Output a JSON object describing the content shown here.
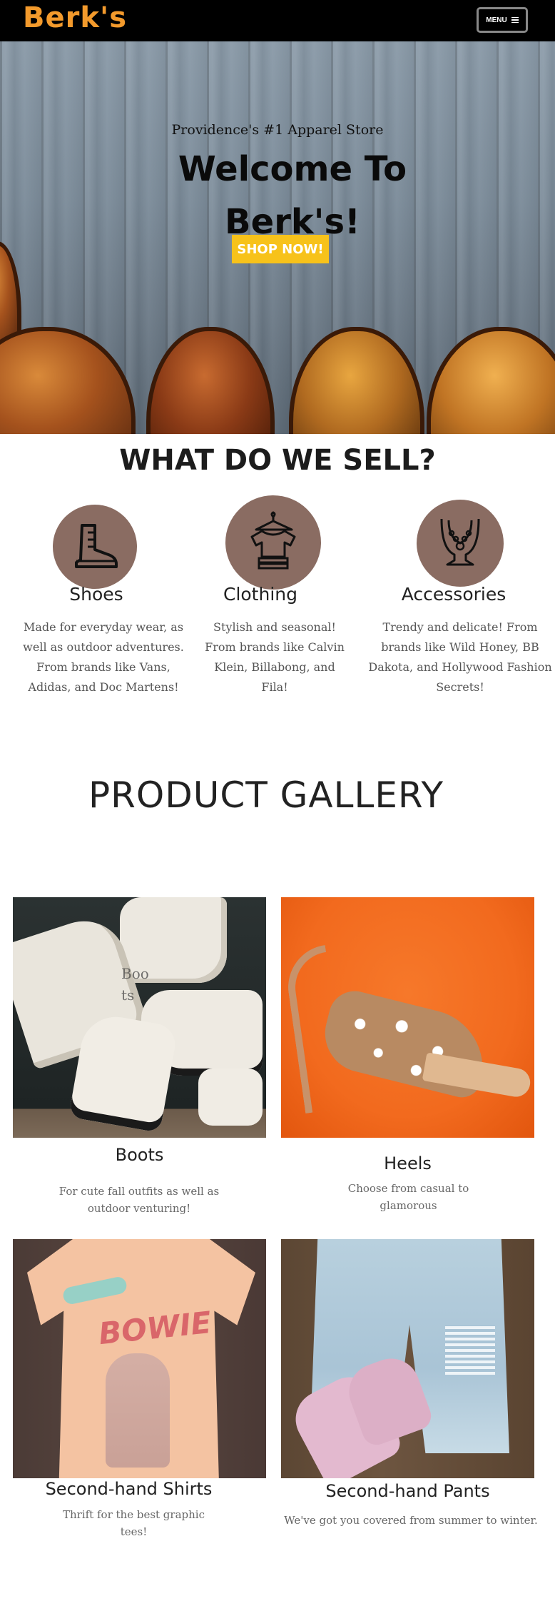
{
  "header": {
    "logo": "Berk's",
    "menu_label": "MENU"
  },
  "hero": {
    "subtitle": "Providence's #1 Apparel Store",
    "title": "Welcome To Berk's!",
    "cta": "SHOP NOW!"
  },
  "sell": {
    "title": "WHAT DO WE SELL?",
    "categories": [
      {
        "name": "Shoes",
        "icon": "boot-icon",
        "desc": "Made for everyday wear, as well as outdoor adventures. From brands like Vans, Adidas, and Doc Martens!"
      },
      {
        "name": "Clothing",
        "icon": "clothing-icon",
        "desc": "Stylish and seasonal! From brands like Calvin Klein, Billabong, and Fila!"
      },
      {
        "name": "Accessories",
        "icon": "necklace-icon",
        "desc": "Trendy and delicate! From brands like Wild Honey, BB Dakota, and Hollywood Fashion Secrets!"
      }
    ]
  },
  "gallery": {
    "title": "PRODUCT GALLERY",
    "items": [
      {
        "name": "Boots",
        "desc": "For cute fall outfits as well as outdoor venturing!",
        "overlay": "Boots"
      },
      {
        "name": "Heels",
        "desc": "Choose from casual to glamorous"
      },
      {
        "name": "Second-hand Shirts",
        "desc": "Thrift for the best graphic tees!",
        "overlay": "BOWIE"
      },
      {
        "name": "Second-hand Pants",
        "desc": "We've got you covered from summer to winter."
      }
    ]
  },
  "colors": {
    "brand_orange": "#f39a2c",
    "cta_yellow": "#f7c21a",
    "icon_circle": "#8a6c62",
    "heels_bg": "#f26a1e"
  }
}
